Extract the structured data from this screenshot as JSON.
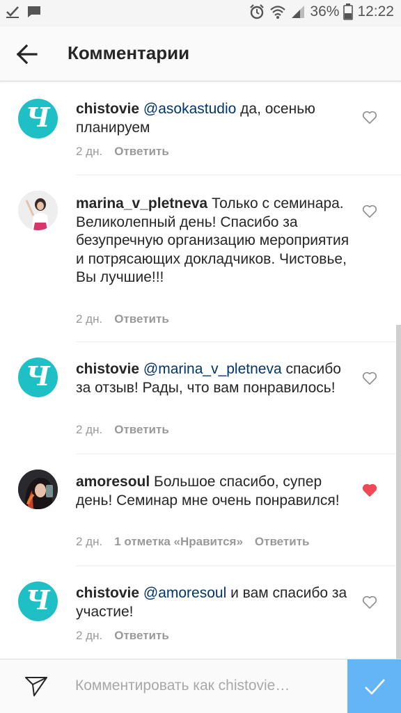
{
  "status_bar": {
    "battery": "36%",
    "time": "12:22",
    "icons": [
      "check-icon",
      "message-icon",
      "alarm-icon",
      "wifi-icon",
      "signal-icon",
      "battery-icon"
    ]
  },
  "header": {
    "title": "Комментарии",
    "back_icon": "arrow-left-icon"
  },
  "comments": [
    {
      "username": "chistovie",
      "mention": "@asokastudio",
      "text": " да,  осенью планируем",
      "time": "2 дн.",
      "likes": "",
      "reply": "Ответить",
      "liked": false,
      "avatar": "logo"
    },
    {
      "username": "marina_v_pletneva",
      "mention": "",
      "text": " Только с семинара. Великолепный день! Спасибо за безупречную организацию мероприятия и потрясающих докладчиков. Чистовье, Вы лучшие!!!",
      "time": "2 дн.",
      "likes": "",
      "reply": "Ответить",
      "liked": false,
      "avatar": "photo"
    },
    {
      "username": "chistovie",
      "mention": "@marina_v_pletneva",
      "text": " спасибо за отзыв! Рады, что вам понравилось!",
      "time": "2 дн.",
      "likes": "",
      "reply": "Ответить",
      "liked": false,
      "avatar": "logo"
    },
    {
      "username": "amoresoul",
      "mention": "",
      "text": " Большое спасибо, супер день! Семинар мне очень понравился!",
      "time": "2 дн.",
      "likes": "1 отметка «Нравится»",
      "reply": "Ответить",
      "liked": true,
      "avatar": "photo"
    },
    {
      "username": "chistovie",
      "mention": "@amoresoul",
      "text": " и вам спасибо за участие!",
      "time": "2 дн.",
      "likes": "",
      "reply": "Ответить",
      "liked": false,
      "avatar": "logo"
    }
  ],
  "logo_letter": "Ч",
  "compose": {
    "placeholder": "Комментировать как chistovie…",
    "value": ""
  },
  "colors": {
    "brand_teal": "#1ec0c5",
    "mention": "#003569",
    "liked_heart": "#ed4956",
    "post_button": "#64b5f6"
  }
}
